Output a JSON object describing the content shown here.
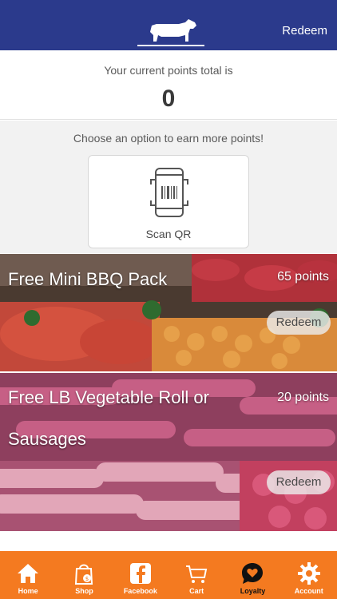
{
  "header": {
    "redeem_label": "Redeem"
  },
  "points": {
    "label": "Your current points total is",
    "value": "0"
  },
  "earn": {
    "label": "Choose an option to earn more points!",
    "scan_label": "Scan QR"
  },
  "rewards": [
    {
      "title": "Free Mini BBQ Pack",
      "points": "65 points",
      "redeem_label": "Redeem"
    },
    {
      "title": "Free LB Vegetable Roll or Sausages",
      "points": "20 points",
      "redeem_label": "Redeem"
    }
  ],
  "tabs": [
    {
      "label": "Home",
      "icon": "home-icon"
    },
    {
      "label": "Shop",
      "icon": "shopping-bag-icon"
    },
    {
      "label": "Facebook",
      "icon": "facebook-icon"
    },
    {
      "label": "Cart",
      "icon": "cart-icon"
    },
    {
      "label": "Loyalty",
      "icon": "heart-chat-icon",
      "active": true
    },
    {
      "label": "Account",
      "icon": "gear-icon"
    }
  ],
  "colors": {
    "header": "#2b3a8c",
    "tabbar": "#f47a20",
    "active_tab": "#111111"
  }
}
